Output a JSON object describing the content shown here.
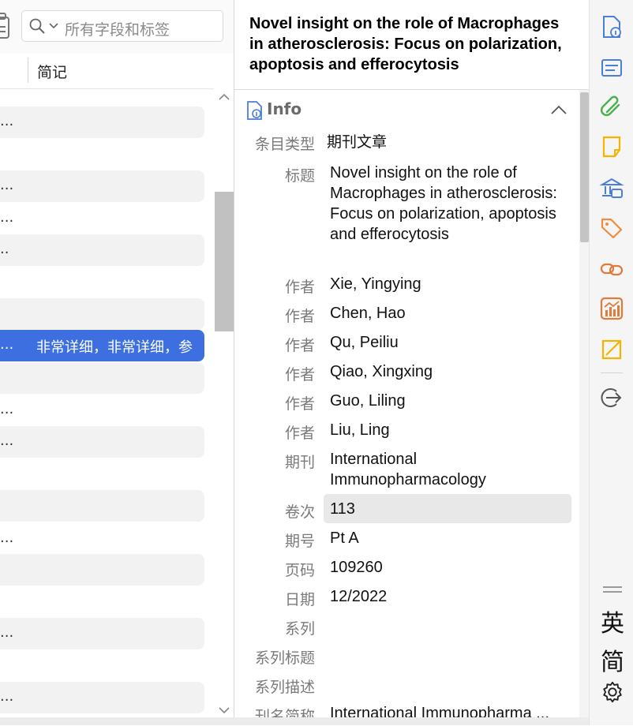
{
  "search": {
    "placeholder": "所有字段和标签"
  },
  "columns": {
    "notes": "简记"
  },
  "items_list": {
    "rows": [
      {
        "text": "..."
      },
      {
        "text": "..."
      },
      {
        "text": "..."
      },
      {
        "text": ".."
      },
      {
        "text": "..."
      },
      {
        "text": "..."
      },
      {
        "text": "..."
      },
      {
        "text": "..."
      },
      {
        "text": "..."
      },
      {
        "text": "..."
      }
    ],
    "selected": {
      "text": "...",
      "note": "非常详细，非常详细，参"
    }
  },
  "item": {
    "title": "Novel insight on the role of Macrophages in atherosclerosis: Focus on polarization, apoptosis and efferocytosis",
    "section": {
      "info_label": "Info"
    },
    "fields": {
      "item_type_label": "条目类型",
      "item_type_value": "期刊文章",
      "title_label": "标题",
      "title_value": "Novel insight on the role of Macrophages in atherosclerosis: Focus on polarization, apoptosis and efferocytosis",
      "creators": [
        {
          "label": "作者",
          "name": "Xie, Yingying"
        },
        {
          "label": "作者",
          "name": "Chen, Hao"
        },
        {
          "label": "作者",
          "name": "Qu, Peiliu"
        },
        {
          "label": "作者",
          "name": "Qiao, Xingxing"
        },
        {
          "label": "作者",
          "name": "Guo, Liling"
        },
        {
          "label": "作者",
          "name": "Liu, Ling"
        }
      ],
      "publication_label": "期刊",
      "publication_value": "International Immunopharmacology",
      "volume_label": "卷次",
      "volume_value": "113",
      "issue_label": "期号",
      "issue_value": "Pt A",
      "pages_label": "页码",
      "pages_value": "109260",
      "date_label": "日期",
      "date_value": "12/2022",
      "series_label": "系列",
      "series_title_label": "系列标题",
      "series_text_label": "系列描述",
      "journal_abbr_label": "刊名简称",
      "journal_abbr_value": "International Immunopharma ..."
    }
  },
  "sidenav": {
    "translate_lang": "英",
    "translate_variant": "简"
  },
  "colors": {
    "selection": "#3d6fe0",
    "info_blue": "#4a7fd9",
    "attachment_green": "#4caf50",
    "notes_yellow": "#f5b400",
    "tags_orange": "#f08c3a"
  }
}
